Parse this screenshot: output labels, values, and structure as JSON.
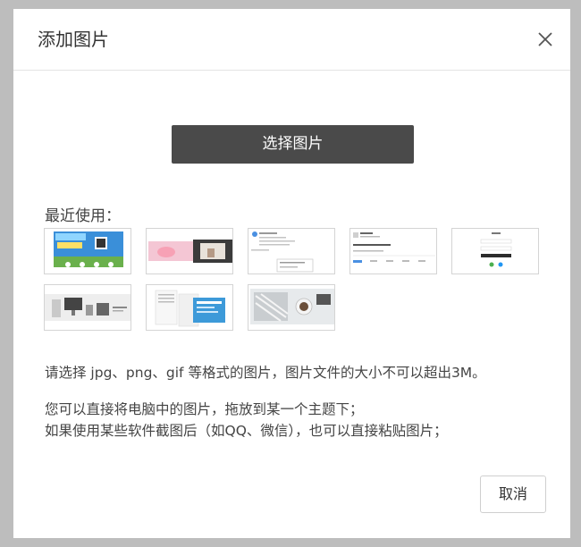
{
  "dialog": {
    "title": "添加图片",
    "close_icon": "close-icon"
  },
  "upload": {
    "select_label": "选择图片"
  },
  "recent": {
    "label": "最近使用：",
    "thumbnails": [
      {
        "name": "thumb-banner-blue"
      },
      {
        "name": "thumb-banner-pink"
      },
      {
        "name": "thumb-post-screenshot"
      },
      {
        "name": "thumb-comment-screenshot"
      },
      {
        "name": "thumb-login-screenshot"
      },
      {
        "name": "thumb-products-banner"
      },
      {
        "name": "thumb-app-screens"
      },
      {
        "name": "thumb-photo-desk"
      }
    ]
  },
  "instructions": {
    "line1": "请选择 jpg、png、gif 等格式的图片，图片文件的大小不可以超出3M。",
    "line2": "您可以直接将电脑中的图片，拖放到某一个主题下；",
    "line3": "如果使用某些软件截图后（如QQ、微信），也可以直接粘贴图片；"
  },
  "footer": {
    "cancel_label": "取消"
  }
}
